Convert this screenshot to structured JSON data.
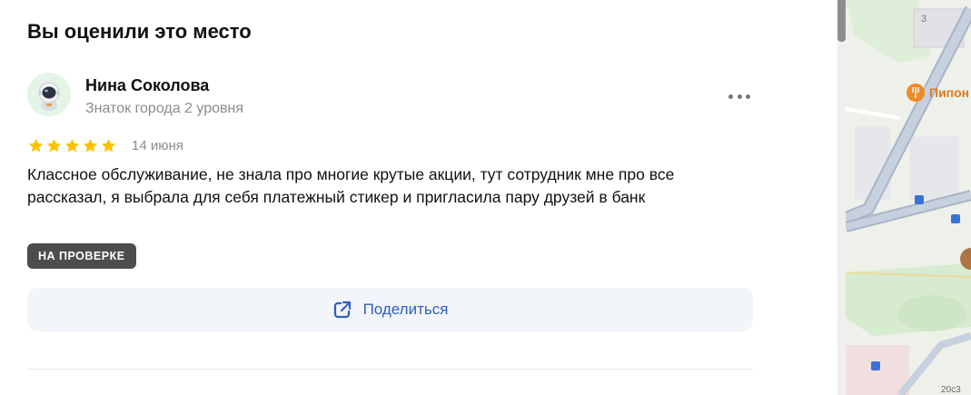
{
  "section": {
    "title": "Вы оценили это место"
  },
  "review": {
    "author_name": "Нина Соколова",
    "author_level": "Знаток города 2 уровня",
    "rating": 5,
    "rating_max": 5,
    "date": "14 июня",
    "text": "Классное обслуживание, не знала про многие крутые акции, тут сотрудник мне про все рассказал, я выбрала для себя платежный стикер и пригласила пару друзей в банк",
    "status": "НА ПРОВЕРКЕ",
    "share_label": "Поделиться",
    "star_color": "#fcc200"
  },
  "map": {
    "place_label": "Пипон",
    "building_number": "3",
    "street_number": "20с3",
    "accent_color": "#f08a24"
  },
  "icons": {
    "avatar": "astronaut-avatar-icon",
    "more": "more-dots-icon",
    "star": "star-icon",
    "share": "share-external-icon"
  }
}
